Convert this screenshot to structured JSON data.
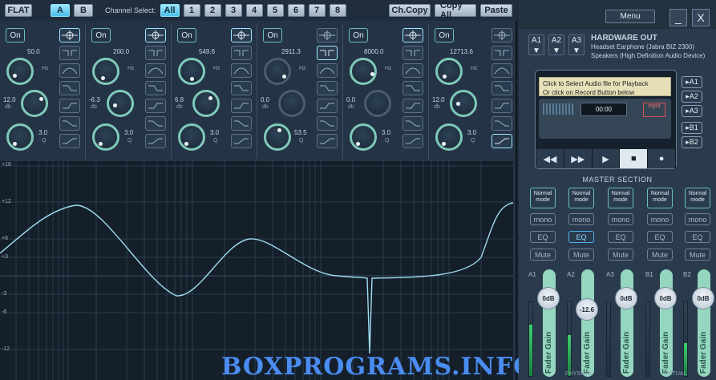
{
  "toolbar": {
    "flat": "FLAT",
    "a": "A",
    "b": "B",
    "channel_select": "Channel Select:",
    "all": "All",
    "channels": [
      "1",
      "2",
      "3",
      "4",
      "5",
      "6",
      "7",
      "8"
    ],
    "ch_copy": "Ch.Copy",
    "copy_all": "Copy All",
    "paste": "Paste"
  },
  "channels": [
    {
      "on": "On",
      "freq": "50.0",
      "gain": "12.0",
      "q": "3.0"
    },
    {
      "on": "On",
      "freq": "200.0",
      "gain": "-6.3",
      "q": "3.0"
    },
    {
      "on": "On",
      "freq": "549.6",
      "gain": "6.8",
      "q": "3.0"
    },
    {
      "on": "On",
      "freq": "2911.3",
      "gain": "0.0",
      "q": "53.5"
    },
    {
      "on": "On",
      "freq": "8000.0",
      "gain": "0.0",
      "q": "3.0"
    },
    {
      "on": "On",
      "freq": "12713.6",
      "gain": "12.0",
      "q": "3.0"
    }
  ],
  "units": {
    "hz": "Hz",
    "db": "db",
    "q": "Q"
  },
  "graph_labels": [
    "+18",
    "+12",
    "+6",
    "+3",
    "-3",
    "-6",
    "-12"
  ],
  "watermark": "BOXPROGRAMS.INFO",
  "right": {
    "menu": "Menu",
    "minimize": "_",
    "close": "X",
    "outputs": [
      "A1",
      "A2",
      "A3"
    ],
    "hw_title": "HARDWARE OUT",
    "hw_devices": [
      "Headset Earphone (Jabra BIZ 2300)",
      "Speakers (High Definition Audio Device)"
    ],
    "playback_line1": "Click to Select Audio file for Playback",
    "playback_line2": "Or click on Record Button below",
    "time": "00:00",
    "input_badge": "input",
    "transport": [
      "◀◀",
      "▶▶",
      "▶",
      "■",
      "●"
    ],
    "buses": [
      "▸A1",
      "▸A2",
      "▸A3",
      "▸B1",
      "▸B2"
    ],
    "master_title": "MASTER SECTION",
    "mode_label": "Normal mode",
    "mono": "mono",
    "eq": "EQ",
    "mute": "Mute",
    "strips": [
      {
        "name": "A1",
        "gain": "0dB",
        "eq_on": false,
        "level": 0.7
      },
      {
        "name": "A2",
        "gain": "-12.6",
        "eq_on": true,
        "level": 0.55
      },
      {
        "name": "A3",
        "gain": "0dB",
        "eq_on": false,
        "level": 0.0
      },
      {
        "name": "B1",
        "gain": "0dB",
        "eq_on": false,
        "level": 0.0
      },
      {
        "name": "B2",
        "gain": "0dB",
        "eq_on": false,
        "level": 0.45
      }
    ],
    "fader_label": "Fader Gain",
    "physical": "PHYSICAL",
    "virtual": "VIRTUAL"
  }
}
